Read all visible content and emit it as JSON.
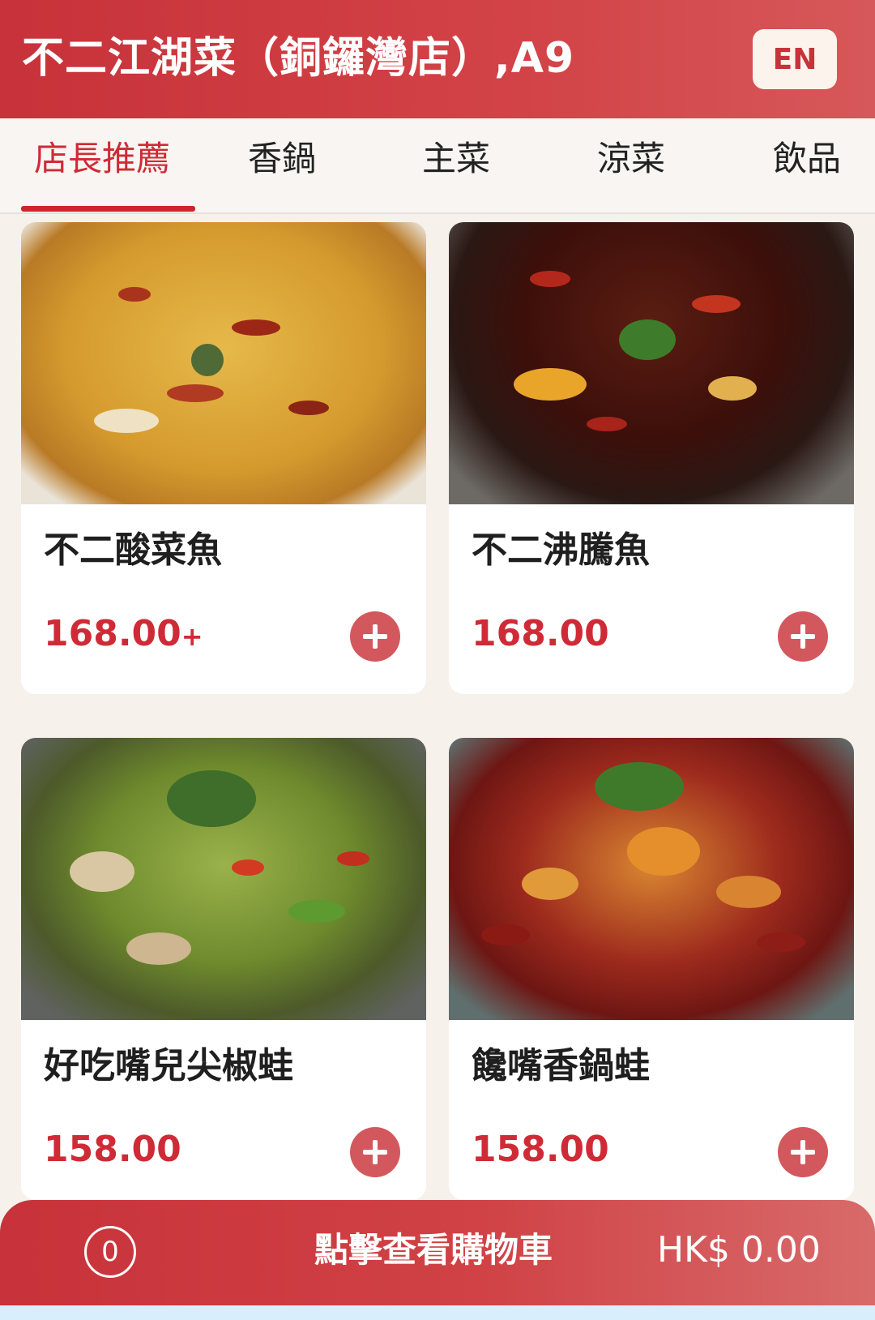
{
  "header": {
    "store_title": "不二江湖菜（銅鑼灣店）,A9",
    "language_button": "EN"
  },
  "tabs": [
    {
      "label": "店長推薦",
      "active": true
    },
    {
      "label": "香鍋",
      "active": false
    },
    {
      "label": "主菜",
      "active": false
    },
    {
      "label": "涼菜",
      "active": false
    },
    {
      "label": "飲品",
      "active": false
    }
  ],
  "menu_items": [
    {
      "name": "不二酸菜魚",
      "price": "168.00",
      "price_suffix": "+"
    },
    {
      "name": "不二沸騰魚",
      "price": "168.00",
      "price_suffix": ""
    },
    {
      "name": "好吃嘴兒尖椒蛙",
      "price": "158.00",
      "price_suffix": ""
    },
    {
      "name": "饞嘴香鍋蛙",
      "price": "158.00",
      "price_suffix": ""
    }
  ],
  "cart": {
    "count": "0",
    "label": "點擊查看購物車",
    "total": "HK$ 0.00"
  },
  "colors": {
    "brand_red": "#c8323a",
    "price_red": "#cf2b37",
    "add_button": "#d3585d"
  }
}
